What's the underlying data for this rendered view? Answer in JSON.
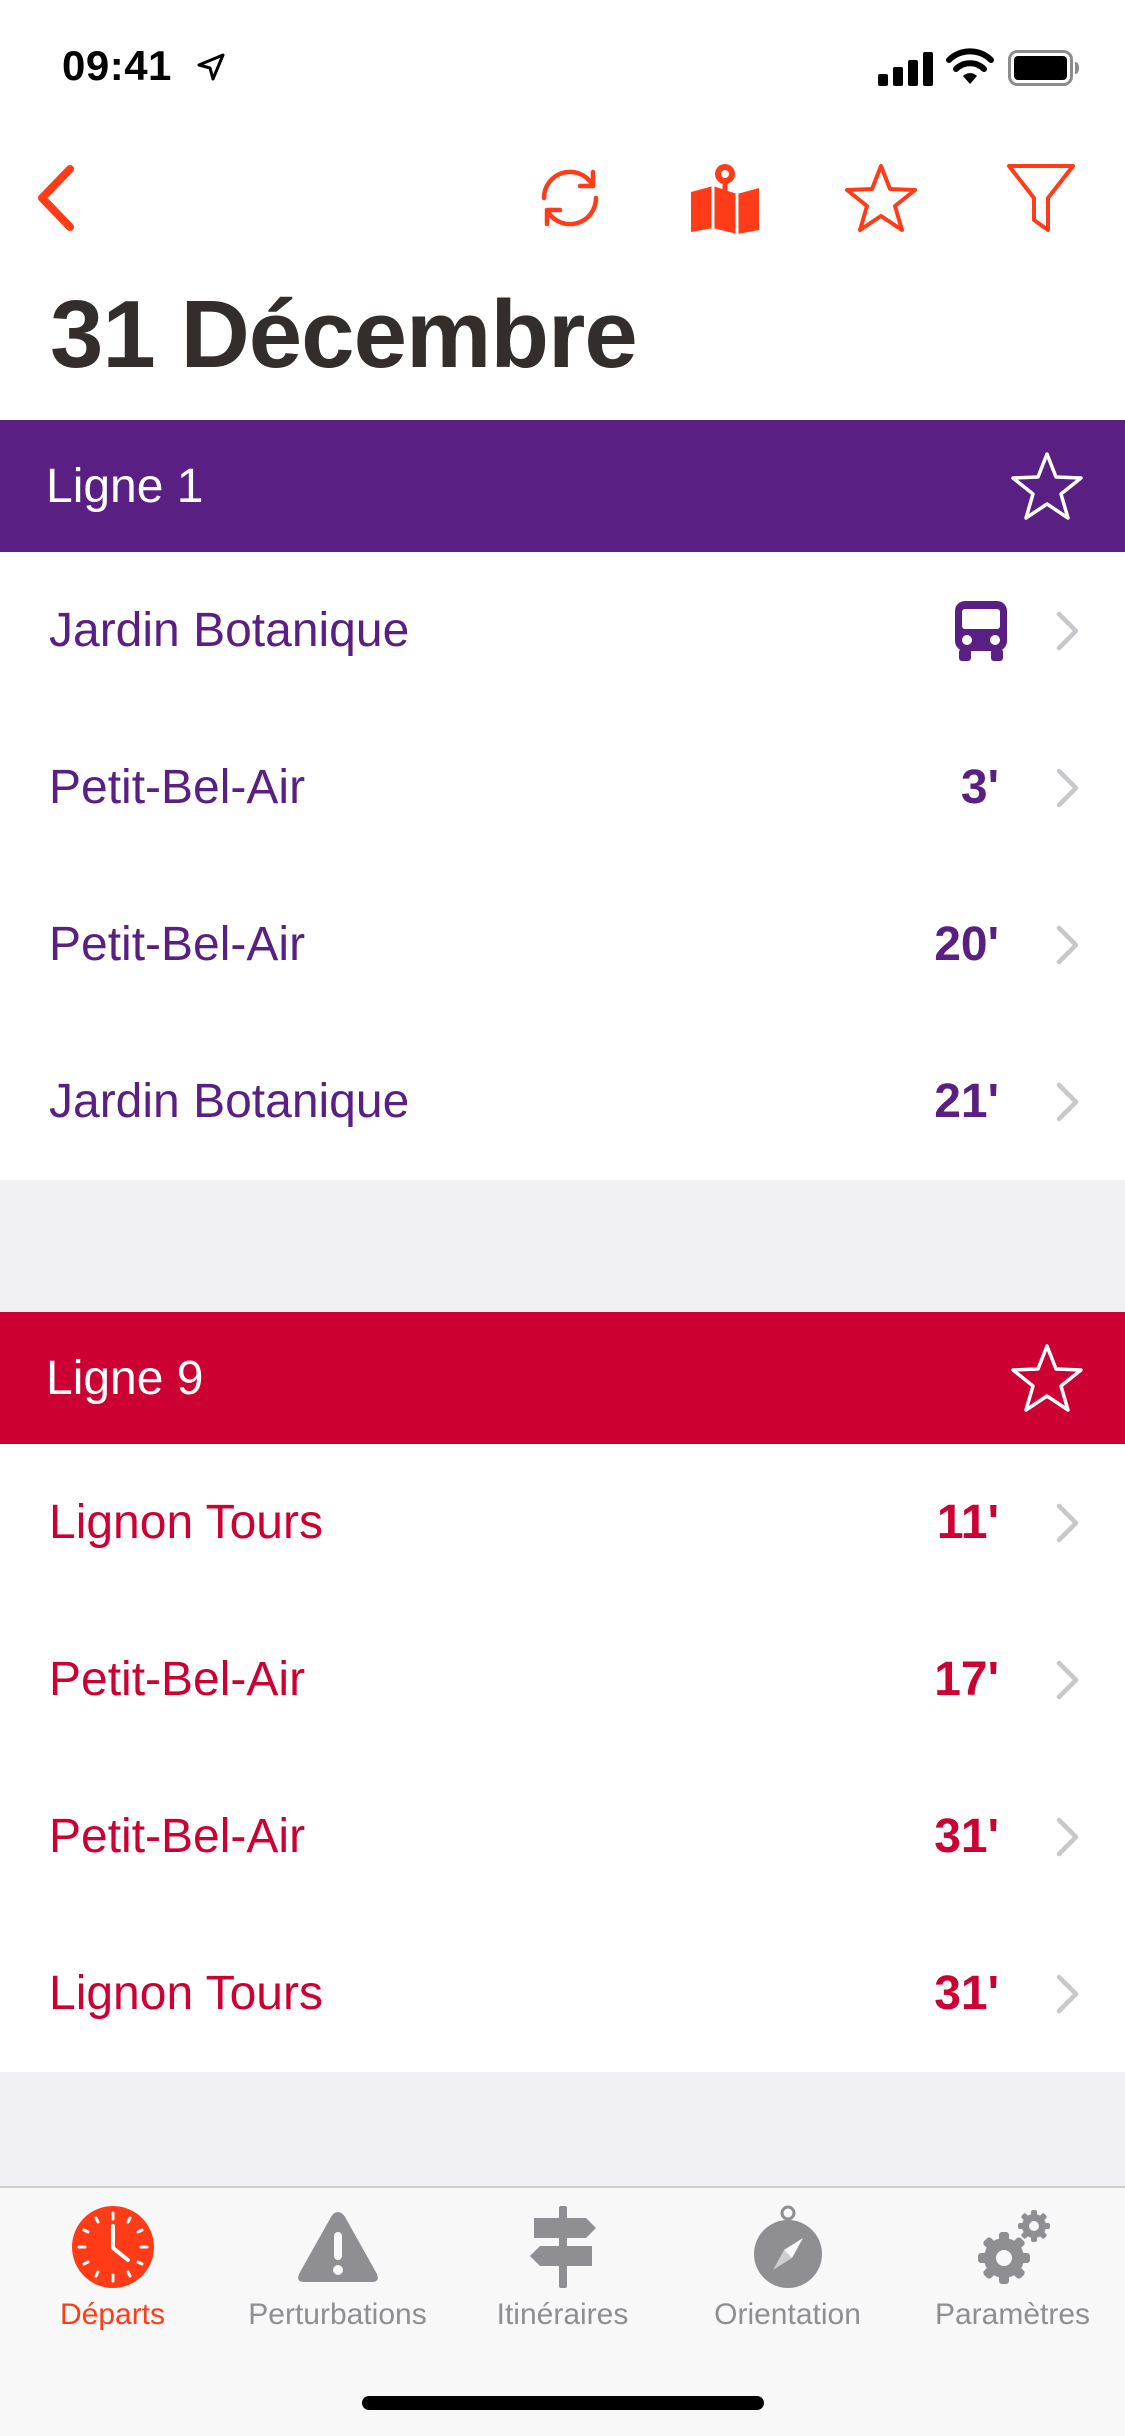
{
  "status_bar": {
    "time": "09:41"
  },
  "nav": {
    "back_icon": "chevron-left-icon",
    "refresh_icon": "refresh-icon",
    "map_icon": "map-pin-icon",
    "favorite_icon": "star-outline-icon",
    "filter_icon": "filter-icon",
    "accent_color": "#ff3b18"
  },
  "page": {
    "title": "31 Décembre"
  },
  "sections": [
    {
      "line_label": "Ligne 1",
      "color": "#5a1f82",
      "departures": [
        {
          "destination": "Jardin Botanique",
          "time": "",
          "icon": "bus-icon"
        },
        {
          "destination": "Petit-Bel-Air",
          "time": "3'"
        },
        {
          "destination": "Petit-Bel-Air",
          "time": "20'"
        },
        {
          "destination": "Jardin Botanique",
          "time": "21'"
        }
      ]
    },
    {
      "line_label": "Ligne 9",
      "color": "#cc0033",
      "departures": [
        {
          "destination": "Lignon Tours",
          "time": "11'"
        },
        {
          "destination": "Petit-Bel-Air",
          "time": "17'"
        },
        {
          "destination": "Petit-Bel-Air",
          "time": "31'"
        },
        {
          "destination": "Lignon Tours",
          "time": "31'"
        }
      ]
    }
  ],
  "tabs": [
    {
      "label": "Départs",
      "icon": "clock-icon",
      "active": true
    },
    {
      "label": "Perturbations",
      "icon": "warning-icon",
      "active": false
    },
    {
      "label": "Itinéraires",
      "icon": "signpost-icon",
      "active": false
    },
    {
      "label": "Orientation",
      "icon": "compass-icon",
      "active": false
    },
    {
      "label": "Paramètres",
      "icon": "gears-icon",
      "active": false
    }
  ]
}
